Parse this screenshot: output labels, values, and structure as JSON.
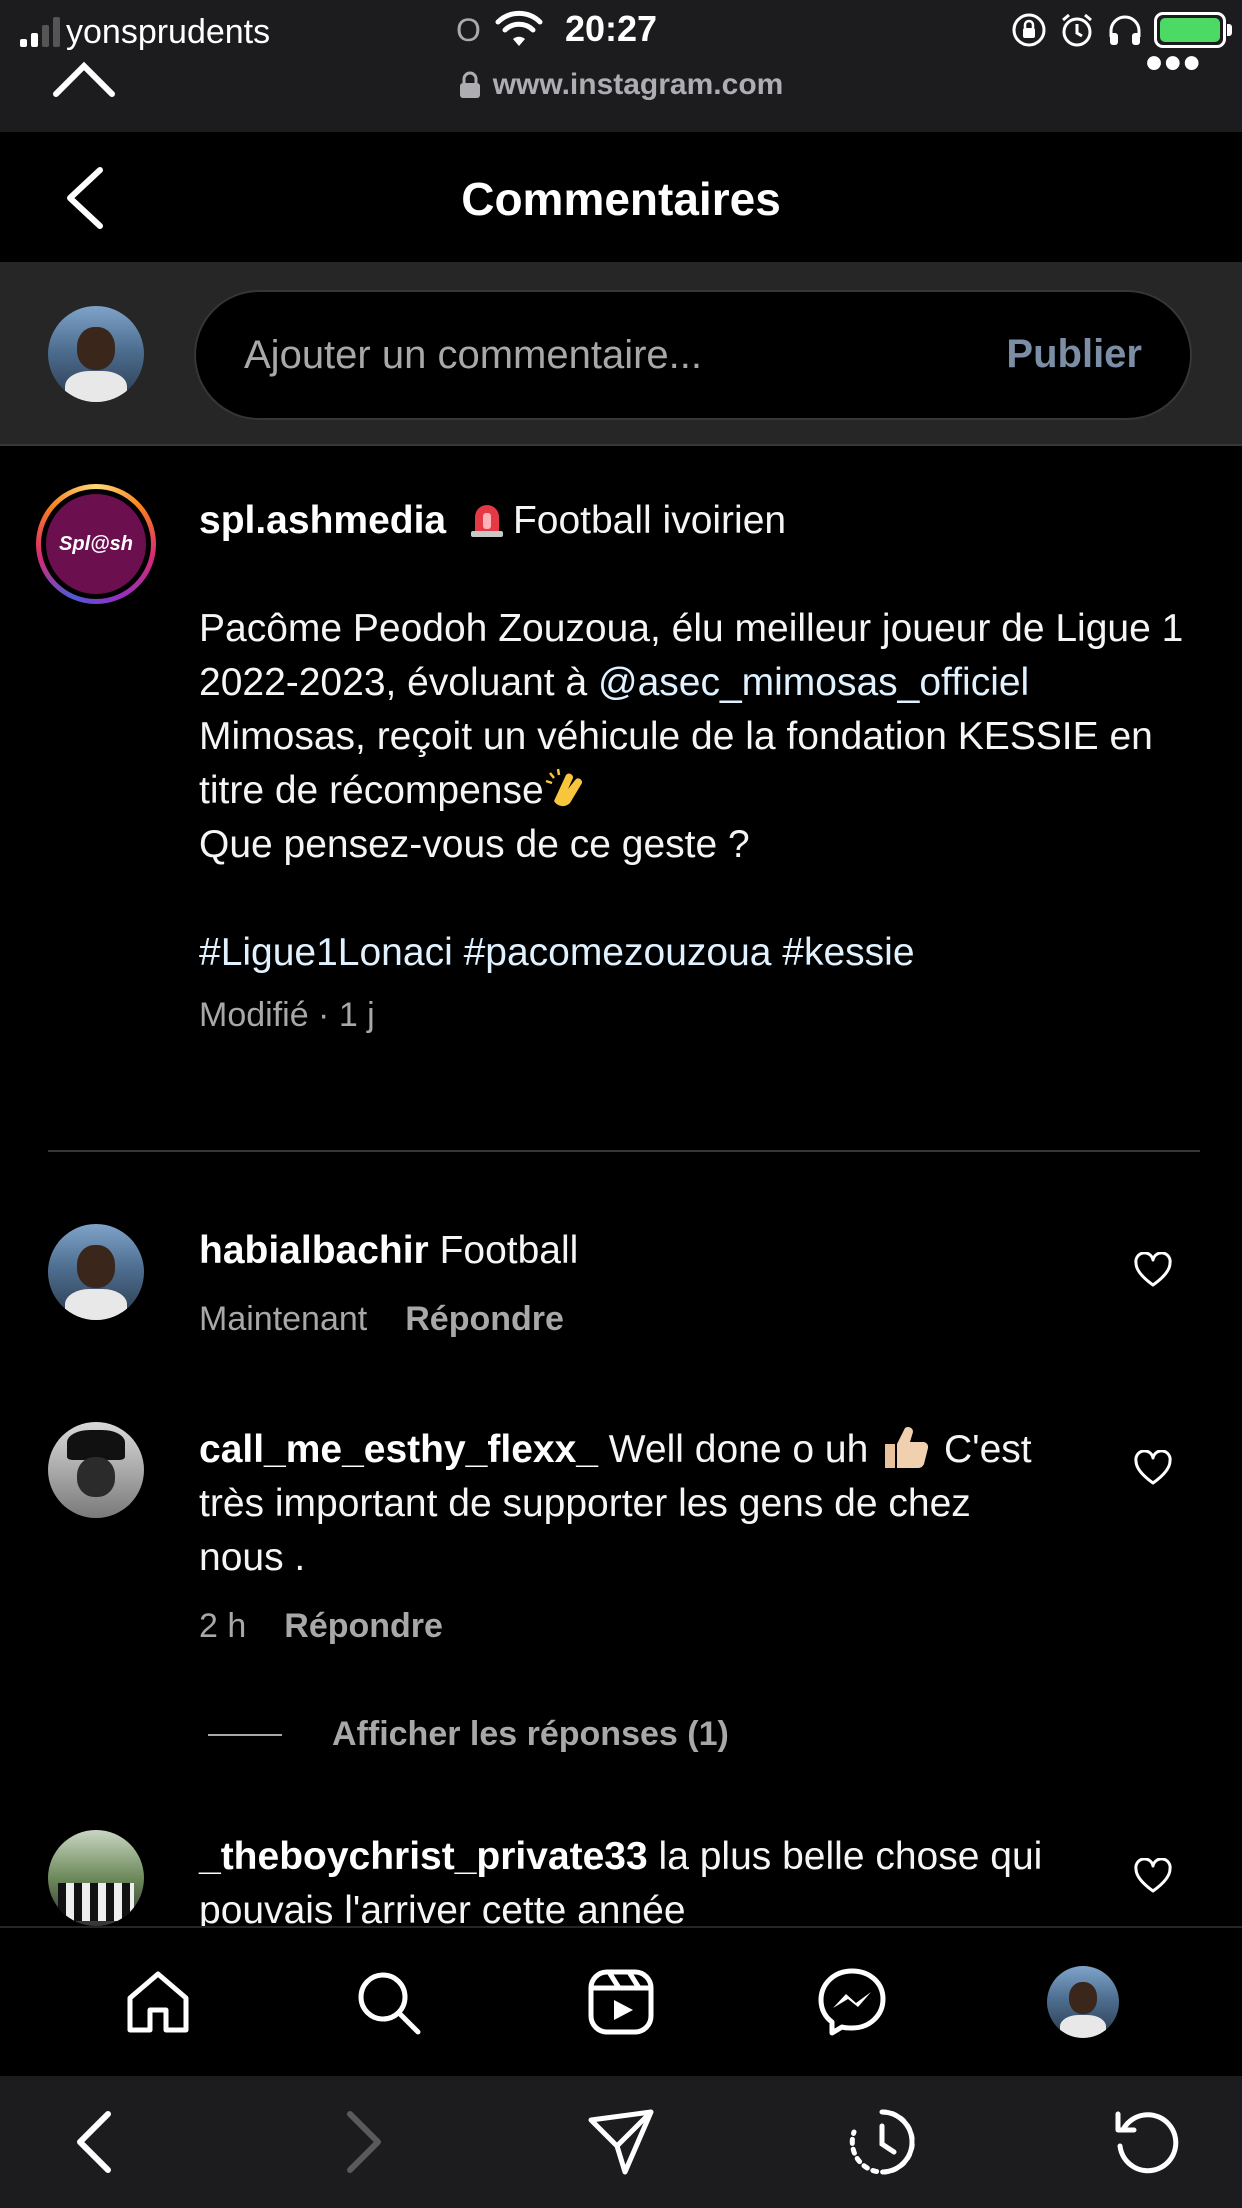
{
  "status_bar": {
    "carrier": "yonsprudents",
    "o_glyph": "O",
    "time": "20:27"
  },
  "browser": {
    "url": "www.instagram.com",
    "more": "•••"
  },
  "header": {
    "title": "Commentaires"
  },
  "composer": {
    "placeholder": "Ajouter un commentaire...",
    "publish_label": "Publier"
  },
  "caption": {
    "avatar_text": "Spl@sh",
    "username": "spl.ashmedia",
    "category": "Football ivoirien",
    "text_before_mention": "Pacôme Peodoh Zouzoua, élu meilleur joueur de Ligue 1 2022-2023, évoluant à",
    "mention": "@asec_mimosas_officiel",
    "text_after_mention": "Mimosas, reçoit un véhicule de la fondation KESSIE en titre de récompense",
    "question": "Que pensez-vous de ce geste ?",
    "hashtags": "#Ligue1Lonaci #pacomezouzoua #kessie",
    "meta": "Modifié · 1 j"
  },
  "comments": [
    {
      "username": "habialbachir",
      "text": "Football",
      "time": "Maintenant",
      "reply_label": "Répondre"
    },
    {
      "username": "call_me_esthy_flexx_",
      "text_before_emoji": "Well done o uh",
      "text_after_emoji": "C'est très important de supporter les gens de chez nous .",
      "time": "2 h",
      "reply_label": "Répondre",
      "view_replies": "Afficher les réponses (1)"
    },
    {
      "username": "_theboychrist_private33",
      "text": "la plus belle chose qui pouvais l'arriver cette année"
    }
  ],
  "colors": {
    "background": "#000000",
    "surface": "#262626",
    "muted_text": "#a8a8a8",
    "publish_disabled": "#7c8ea6",
    "battery_green": "#4cd964"
  },
  "icons": {
    "nav": [
      "home-icon",
      "search-icon",
      "reels-icon",
      "messenger-icon",
      "profile-avatar"
    ],
    "safari": [
      "back-icon",
      "forward-icon",
      "share-icon",
      "history-icon",
      "reload-icon"
    ]
  }
}
